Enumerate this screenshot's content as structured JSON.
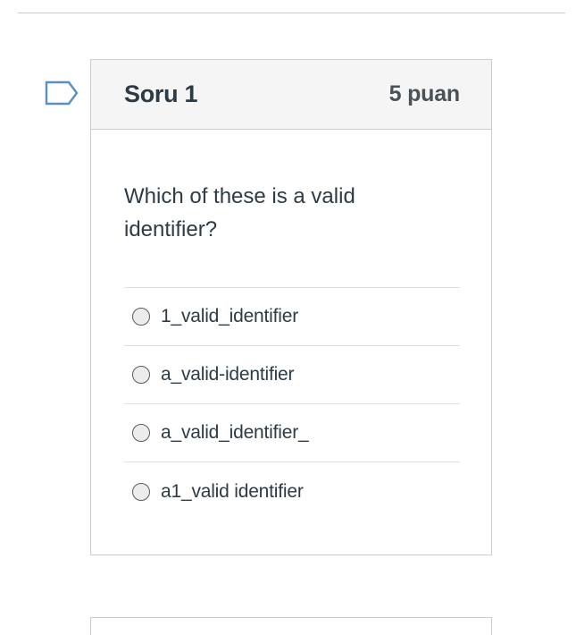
{
  "question": {
    "title": "Soru 1",
    "points": "5 puan",
    "text": "Which of these is a valid identifier?",
    "answers": [
      {
        "label": "1_valid_identifier",
        "selected": false
      },
      {
        "label": "a_valid-identifier",
        "selected": false
      },
      {
        "label": "a_valid_identifier_",
        "selected": false
      },
      {
        "label": "a1_valid identifier",
        "selected": false
      }
    ]
  },
  "colors": {
    "border": "#c7cdd1",
    "header_bg": "#f5f5f5",
    "text": "#2d3b45",
    "flag": "#5b8fc8"
  },
  "icons": {
    "flag": "flag-question-icon"
  }
}
